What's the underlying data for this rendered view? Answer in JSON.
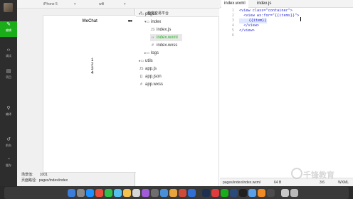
{
  "rail": {
    "items": [
      {
        "label": "编辑",
        "icon": "pencil-icon",
        "active": true
      },
      {
        "label": "调试",
        "icon": "code-brackets-icon"
      },
      {
        "label": "项目",
        "icon": "project-icon"
      },
      {
        "label": "编译",
        "icon": "compile-icon"
      },
      {
        "label": "前台",
        "icon": "foreground-icon"
      },
      {
        "label": "缓存",
        "icon": "cache-icon"
      }
    ]
  },
  "toolbar": {
    "device": "iPhone 5",
    "network": "wifi"
  },
  "simulator": {
    "nav_title": "WeChat",
    "menu_icon": "•••",
    "items": [
      "1",
      "2",
      "3",
      "4"
    ],
    "scene_label": "场景值:",
    "scene_value": "1001",
    "path_label": "页面路径:",
    "path_value": "pages/index/index"
  },
  "project": {
    "title": "萌宠交易平台",
    "tree": [
      {
        "name": "pages",
        "kind": "folder",
        "expanded": true
      },
      {
        "name": "index",
        "kind": "folder",
        "expanded": true
      },
      {
        "name": "index.js",
        "kind": "js"
      },
      {
        "name": "index.wxml",
        "kind": "wxml"
      },
      {
        "name": "index.wxss",
        "kind": "wxss"
      },
      {
        "name": "logs",
        "kind": "folder",
        "expanded": false
      },
      {
        "name": "utils",
        "kind": "folder",
        "expanded": false
      },
      {
        "name": "app.js",
        "kind": "js"
      },
      {
        "name": "app.json",
        "kind": "json"
      },
      {
        "name": "app.wxss",
        "kind": "wxss"
      }
    ]
  },
  "editor": {
    "tabs": [
      {
        "label": "index.wxml",
        "active": true
      },
      {
        "label": "index.js",
        "active": false
      }
    ],
    "lines": [
      {
        "num": "1",
        "text": "<view class=\"container\">"
      },
      {
        "num": "2",
        "text": "  <view wx:for=\"{{items}}\">"
      },
      {
        "num": "3",
        "text": "    {{item}}"
      },
      {
        "num": "4",
        "text": "  </view>"
      },
      {
        "num": "5",
        "text": "</view>"
      },
      {
        "num": "6",
        "text": ""
      }
    ],
    "status": {
      "path": "pages/index/index.wxml",
      "size": "64 B",
      "position": "3:6",
      "language": "WXML"
    }
  },
  "watermark": "千锋教育",
  "colors": {
    "accent": "#1aad19",
    "rail_bg": "#2d2d2d",
    "code_tag": "#2b2bd8"
  }
}
